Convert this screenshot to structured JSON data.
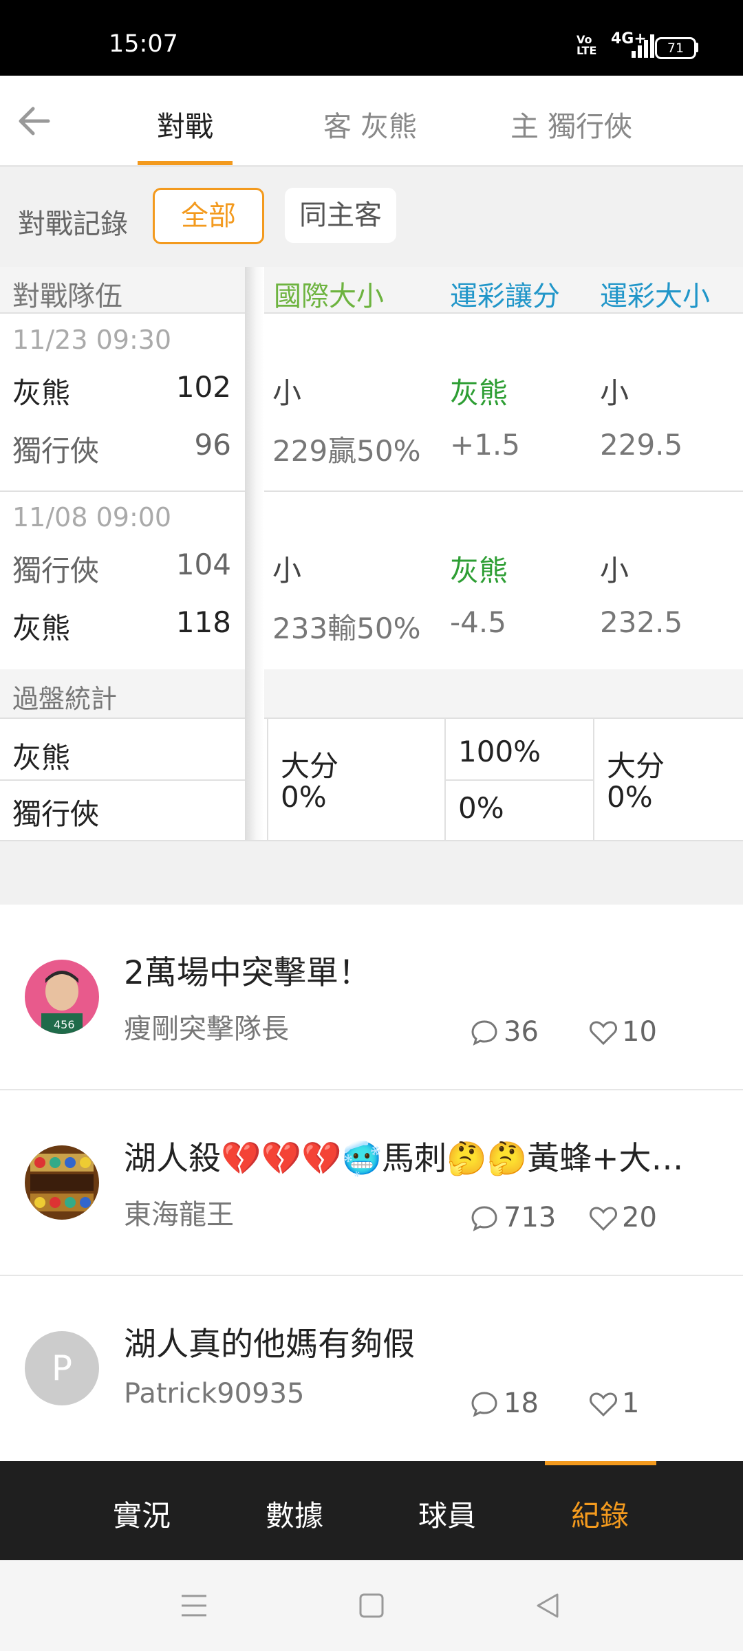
{
  "status_bar": {
    "time": "15:07",
    "volte": "Vo LTE",
    "network": "4G+",
    "battery": "71"
  },
  "header": {
    "back_icon": "arrow-left-icon",
    "tabs": [
      {
        "label": "對戰",
        "active": true
      },
      {
        "label": "客 灰熊",
        "active": false
      },
      {
        "label": "主 獨行俠",
        "active": false
      }
    ]
  },
  "filter": {
    "label": "對戰記錄",
    "options": [
      {
        "label": "全部",
        "active": true
      },
      {
        "label": "同主客",
        "active": false
      }
    ]
  },
  "table": {
    "headers": {
      "team": "對戰隊伍",
      "intl_total": "國際大小",
      "lottery_spread": "運彩讓分",
      "lottery_total": "運彩大小"
    },
    "matches": [
      {
        "date": "11/23 09:30",
        "rows": [
          {
            "team": "灰熊",
            "score": "102",
            "intl": "小",
            "spread": "灰熊",
            "total": "小"
          },
          {
            "team": "獨行俠",
            "score": "96",
            "intl": "229贏50%",
            "spread": "+1.5",
            "total": "229.5"
          }
        ]
      },
      {
        "date": "11/08 09:00",
        "rows": [
          {
            "team": "獨行俠",
            "score": "104",
            "intl": "小",
            "spread": "灰熊",
            "total": "小"
          },
          {
            "team": "灰熊",
            "score": "118",
            "intl": "233輸50%",
            "spread": "-4.5",
            "total": "232.5"
          }
        ]
      }
    ],
    "stats": {
      "title": "過盤統計",
      "teams": [
        "灰熊",
        "獨行俠"
      ],
      "intl": {
        "label": "大分",
        "value": "0%"
      },
      "spread": {
        "top": "100%",
        "bottom": "0%"
      },
      "total": {
        "label": "大分",
        "value": "0%"
      }
    }
  },
  "posts": [
    {
      "title": "2萬場中突擊單！",
      "author": "痩剛突擊隊長",
      "comments": "36",
      "likes": "10",
      "avatar": "avatar-photo"
    },
    {
      "title": "湖人殺💔💔💔🥶馬刺🤔🤔黃蜂+大分…",
      "author": "東海龍王",
      "comments": "713",
      "likes": "20",
      "avatar": "avatar-photo"
    },
    {
      "title": "湖人真的他媽有夠假",
      "author": "Patrick90935",
      "comments": "18",
      "likes": "1",
      "avatar_letter": "P"
    }
  ],
  "bottom_tabs": [
    {
      "label": "實況",
      "active": false
    },
    {
      "label": "數據",
      "active": false
    },
    {
      "label": "球員",
      "active": false
    },
    {
      "label": "紀錄",
      "active": true
    }
  ],
  "colors": {
    "accent": "#f39a1e",
    "green": "#2e9e34",
    "blue": "#2196c9",
    "dark_bar": "#1f1f1f"
  }
}
